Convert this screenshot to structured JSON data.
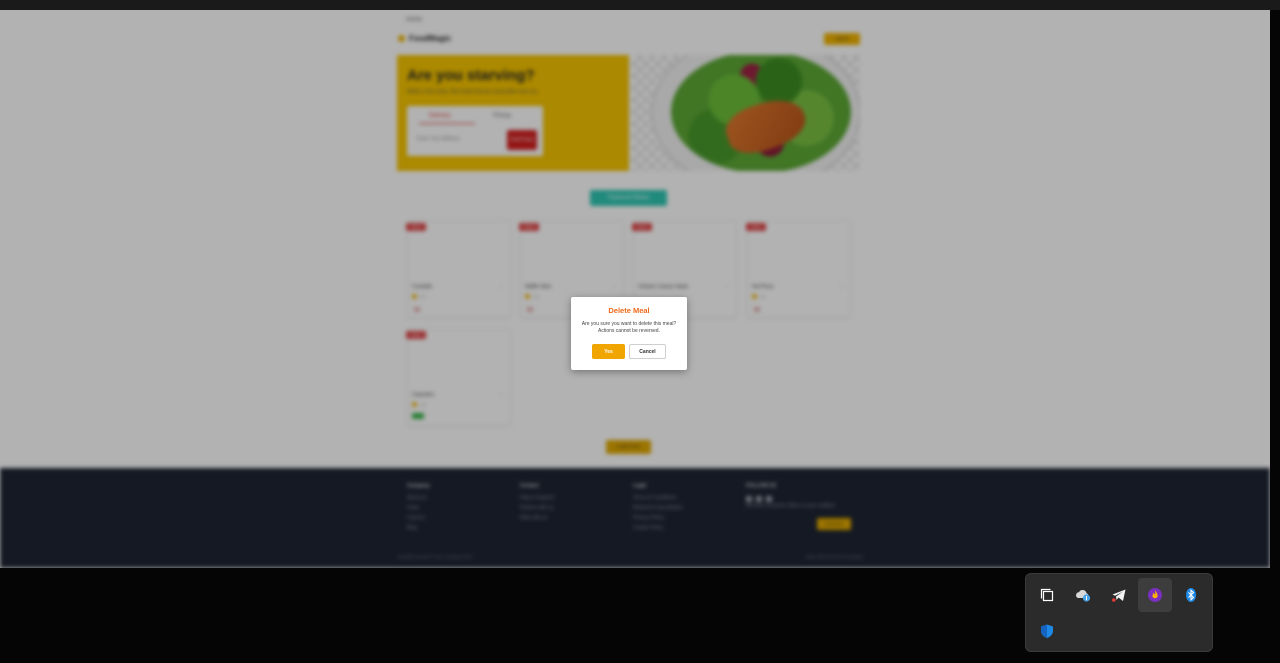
{
  "page": {
    "header_tiny": "Home",
    "brand": "FoodMagic",
    "login_label": "Log In",
    "hero": {
      "title": "Are you starving?",
      "subtitle": "Within a few clicks, find meals that are accessible near you",
      "tab_delivery": "Delivery",
      "tab_pickup": "Pickup",
      "address_placeholder": "Enter Your Address",
      "find_button": "Find Food"
    },
    "featured_label": "Featured Meals",
    "cards": [
      {
        "name": "Cocktails",
        "badge": "Meal",
        "price": "5.0"
      },
      {
        "name": "Waffle Stick",
        "badge": "Meal",
        "price": "4.5"
      },
      {
        "name": "Chicken Caesar Salad",
        "badge": "Meal",
        "price": ""
      },
      {
        "name": "Hot Pizza",
        "badge": "Meal",
        "price": "4.0"
      },
      {
        "name": "Cupcakes",
        "badge": "Meal",
        "price": "4.5"
      }
    ],
    "load_more": "Load more",
    "footer": {
      "col1": {
        "head": "Company",
        "items": [
          "About us",
          "Team",
          "Careers",
          "Blog"
        ]
      },
      "col2": {
        "head": "Contact",
        "items": [
          "Help & Support",
          "Partner with us",
          "Ride with us"
        ]
      },
      "col3": {
        "head": "Legal",
        "items": [
          "Terms & Conditions",
          "Refund & Cancellation",
          "Privacy Policy",
          "Cookie Policy"
        ]
      },
      "col4": {
        "head": "FOLLOW US",
        "note": "Receive exclusive offers in your mailbox"
      },
      "subscribe_label": "Subscribe",
      "copyright": "All rights reserved © Your Company, 2022",
      "made_with": "Made with love by Themewagon"
    }
  },
  "modal": {
    "title": "Delete Meal",
    "message": "Are you sure you want to delete this meal? Actions cannot be reversed.",
    "yes_label": "Yes",
    "cancel_label": "Cancel"
  },
  "tray": {
    "icons": [
      "window-restore-icon",
      "onedrive-cloud-icon",
      "telegram-icon",
      "app-flame-icon",
      "bluetooth-icon",
      "windows-security-icon"
    ]
  },
  "colors": {
    "accent": "#f0a500",
    "modal_title": "#ee6a1b",
    "hero_bg": "#f5c400",
    "featured": "#2fc7b3",
    "footer_bg": "#1e2533"
  }
}
